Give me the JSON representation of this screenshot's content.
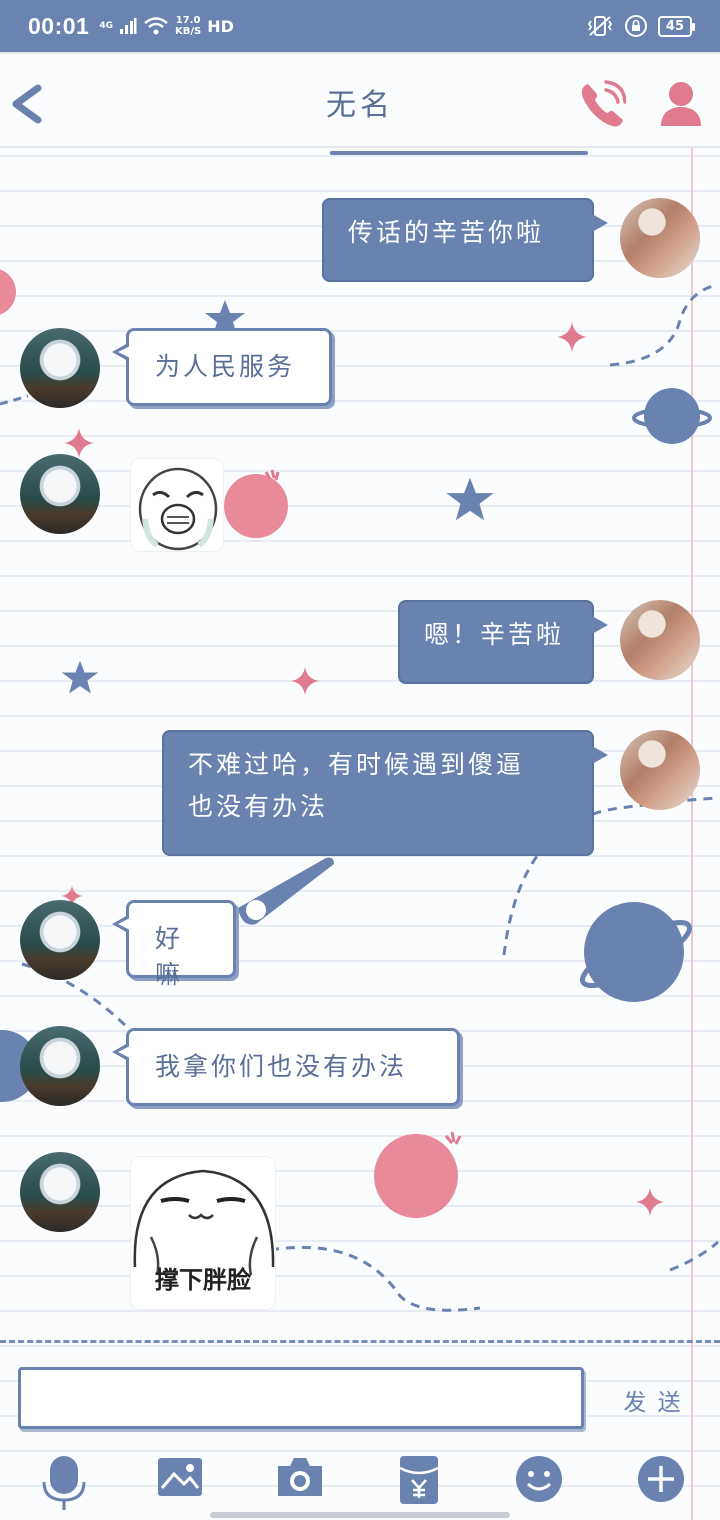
{
  "status_bar": {
    "time": "00:01",
    "network": "4G",
    "speed_value": "17.0",
    "speed_unit": "KB/S",
    "hd": "HD",
    "battery": "45"
  },
  "header": {
    "title": "无名",
    "back_icon": "chevron-left-icon",
    "call_icon": "phone-icon",
    "profile_icon": "person-icon"
  },
  "messages": [
    {
      "side": "out",
      "type": "text",
      "text": "传话的辛苦你啦"
    },
    {
      "side": "in",
      "type": "text",
      "text": "为人民服务"
    },
    {
      "side": "in",
      "type": "sticker",
      "sticker": "crying-face-sticker"
    },
    {
      "side": "out",
      "type": "text",
      "text": "嗯！辛苦啦"
    },
    {
      "side": "out",
      "type": "text",
      "lines": [
        "不难过哈，有时候遇到傻逼",
        "也没有办法"
      ]
    },
    {
      "side": "in",
      "type": "text",
      "text": "好嘛"
    },
    {
      "side": "in",
      "type": "text",
      "text": "我拿你们也没有办法"
    },
    {
      "side": "in",
      "type": "sticker",
      "sticker": "smug-face-sticker",
      "caption": "撑下胖脸"
    }
  ],
  "input": {
    "value": "",
    "placeholder": "",
    "send_label": "发 送"
  },
  "toolbar": [
    "microphone-icon",
    "image-icon",
    "camera-icon",
    "red-packet-icon",
    "emoji-icon",
    "plus-icon"
  ],
  "colors": {
    "primary": "#6a82af",
    "accent_pink": "#e07b8f",
    "status_bar": "#6a83b1"
  }
}
